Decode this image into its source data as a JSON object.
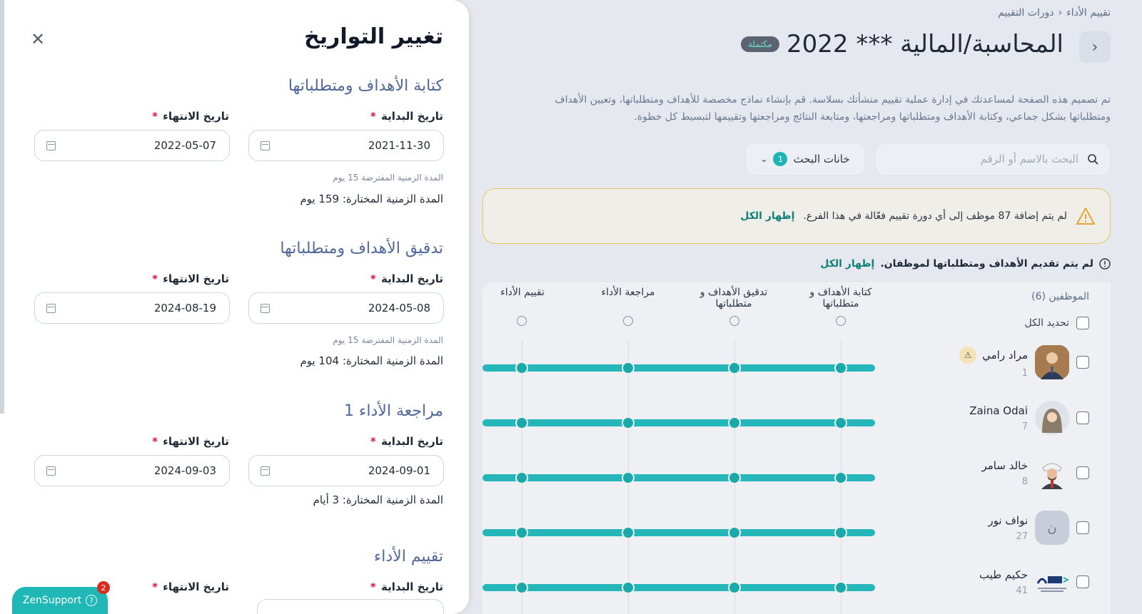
{
  "breadcrumb": {
    "root": "تقييم الأداء",
    "current": "دورات التقييم"
  },
  "page": {
    "title": "المحاسبة/المالية *** 2022",
    "status": "مكتملة",
    "description": "تم تصميم هذه الصفحة لمساعدتك في إدارة عملية تقييم منشأتك بسلاسة. قم بإنشاء نماذج مخصصة للأهداف ومتطلباتها، وتعيين الأهداف ومتطلباتها بشكل جماعي، وكتابة الأهداف ومتطلباتها ومراجعتها، ومتابعة النتائج ومراجعتها وتقييمها لتبسيط كل خطوة."
  },
  "search": {
    "placeholder": "البحث بالاسم أو الرقم"
  },
  "filter": {
    "label": "خانات البحث",
    "count": "1"
  },
  "warning": {
    "text": "لم يتم إضافة 87 موظف إلى أي دورة تقييم فعّالة في هذا الفرع.",
    "link": "إظهار الكل"
  },
  "note": {
    "text": "لم يتم تقديم الأهداف ومتطلباتها لموظفان.",
    "link": "إظهار الكل"
  },
  "table": {
    "employees_header": "الموظفين (6)",
    "select_all": "تحديد الكل",
    "stages": [
      "كتابة الأهداف و متطلباتها",
      "تدقيق الأهداف و متطلباتها",
      "مراجعة الأداء",
      "تقييم الأداء"
    ],
    "employees": [
      {
        "name": "مراد رامي",
        "num": "1",
        "avatar": "person-photo",
        "warn": true
      },
      {
        "name": "Zaina Odai",
        "num": "7",
        "avatar": "woman-avatar",
        "warn": false
      },
      {
        "name": "خالد سامر",
        "num": "8",
        "avatar": "man-avatar",
        "warn": false
      },
      {
        "name": "نواف نور",
        "num": "27",
        "avatar": "ن",
        "warn": false
      },
      {
        "name": "حكيم طيب",
        "num": "41",
        "avatar": "gosi-logo",
        "warn": false
      }
    ]
  },
  "panel": {
    "title": "تغيير التواريخ",
    "start_label": "تاريخ البداية",
    "end_label": "تاريخ الانتهاء",
    "sections": [
      {
        "title": "كتابة الأهداف ومتطلباتها",
        "start": "2021-11-30",
        "end": "2022-05-07",
        "hint": "المدة الزمنية المفترضة 15 يوم",
        "duration": "المدة الزمنية المختارة: 159 يوم"
      },
      {
        "title": "تدقيق الأهداف ومتطلباتها",
        "start": "2024-05-08",
        "end": "2024-08-19",
        "hint": "المدة الزمنية المفترضة 15 يوم",
        "duration": "المدة الزمنية المختارة: 104 يوم"
      },
      {
        "title": "مراجعة الأداء 1",
        "start": "2024-09-01",
        "end": "2024-09-03",
        "hint": "",
        "duration": "المدة الزمنية المختارة: 3 أيام"
      },
      {
        "title": "تقييم الأداء",
        "start": "",
        "end": "",
        "hint": "",
        "duration": ""
      }
    ]
  },
  "zen": {
    "label": "ZenSupport",
    "badge": "2"
  },
  "colors": {
    "accent": "#20b7b7",
    "title_blue": "#50689a",
    "warning_border": "#e7c765"
  }
}
